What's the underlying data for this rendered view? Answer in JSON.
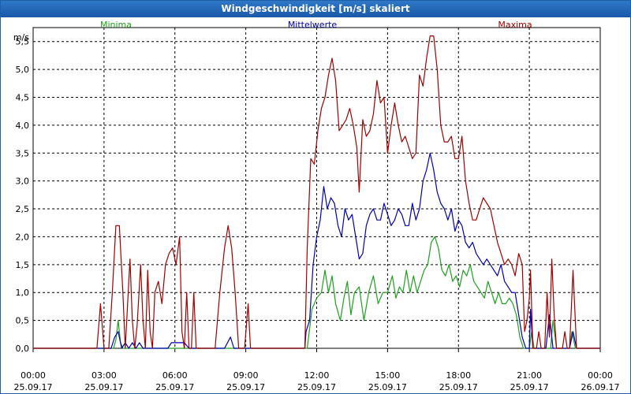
{
  "window": {
    "title": "Windgeschwindigkeit [m/s] skaliert"
  },
  "chart_data": {
    "type": "line",
    "title": "Windgeschwindigkeit [m/s] skaliert",
    "ylabel": "m/s",
    "ylim": [
      0,
      5.75
    ],
    "xlim": [
      "25.09.17 00:00",
      "26.09.17 00:00"
    ],
    "grid": true,
    "legend": "top",
    "y_ticks": [
      "0,0",
      "0,5",
      "1,0",
      "1,5",
      "2,0",
      "2,5",
      "3,0",
      "3,5",
      "4,0",
      "4,5",
      "5,0",
      "5,5"
    ],
    "x_ticks": [
      {
        "time": "00:00",
        "date": "25.09.17"
      },
      {
        "time": "03:00",
        "date": "25.09.17"
      },
      {
        "time": "06:00",
        "date": "25.09.17"
      },
      {
        "time": "09:00",
        "date": "25.09.17"
      },
      {
        "time": "12:00",
        "date": "25.09.17"
      },
      {
        "time": "15:00",
        "date": "25.09.17"
      },
      {
        "time": "18:00",
        "date": "25.09.17"
      },
      {
        "time": "21:00",
        "date": "25.09.17"
      },
      {
        "time": "00:00",
        "date": "26.09.17"
      }
    ],
    "x_unit": "hours since 25.09.17 00:00",
    "series": [
      {
        "name": "Minima",
        "color": "#1fa01f",
        "points": [
          [
            0,
            0
          ],
          [
            3.4,
            0
          ],
          [
            3.5,
            0.15
          ],
          [
            3.6,
            0.5
          ],
          [
            3.7,
            0.1
          ],
          [
            3.8,
            0
          ],
          [
            11.6,
            0
          ],
          [
            11.8,
            0.7
          ],
          [
            12,
            0.9
          ],
          [
            12.2,
            1.0
          ],
          [
            12.35,
            1.4
          ],
          [
            12.5,
            1.0
          ],
          [
            12.65,
            1.3
          ],
          [
            12.8,
            0.8
          ],
          [
            13.0,
            0.5
          ],
          [
            13.15,
            0.9
          ],
          [
            13.3,
            1.2
          ],
          [
            13.45,
            0.6
          ],
          [
            13.6,
            1.0
          ],
          [
            13.8,
            1.1
          ],
          [
            14.0,
            0.5
          ],
          [
            14.2,
            1.0
          ],
          [
            14.4,
            1.3
          ],
          [
            14.6,
            0.8
          ],
          [
            14.8,
            1.0
          ],
          [
            15.0,
            1.0
          ],
          [
            15.2,
            1.3
          ],
          [
            15.35,
            0.9
          ],
          [
            15.5,
            1.1
          ],
          [
            15.65,
            1.0
          ],
          [
            15.8,
            1.4
          ],
          [
            15.95,
            1.0
          ],
          [
            16.1,
            1.3
          ],
          [
            16.25,
            1.0
          ],
          [
            16.4,
            1.2
          ],
          [
            16.55,
            1.4
          ],
          [
            16.7,
            1.5
          ],
          [
            16.85,
            1.9
          ],
          [
            17.0,
            2.0
          ],
          [
            17.15,
            1.8
          ],
          [
            17.3,
            1.4
          ],
          [
            17.45,
            1.3
          ],
          [
            17.6,
            1.5
          ],
          [
            17.75,
            1.2
          ],
          [
            17.9,
            1.3
          ],
          [
            18.05,
            1.1
          ],
          [
            18.2,
            1.4
          ],
          [
            18.35,
            1.3
          ],
          [
            18.5,
            1.5
          ],
          [
            18.65,
            1.2
          ],
          [
            18.8,
            1.1
          ],
          [
            18.95,
            1.0
          ],
          [
            19.1,
            0.9
          ],
          [
            19.25,
            1.2
          ],
          [
            19.4,
            1.0
          ],
          [
            19.55,
            0.8
          ],
          [
            19.7,
            1.0
          ],
          [
            19.85,
            0.8
          ],
          [
            20.0,
            0.8
          ],
          [
            20.15,
            0.9
          ],
          [
            20.3,
            0.8
          ],
          [
            20.45,
            0.6
          ],
          [
            20.6,
            0.2
          ],
          [
            20.75,
            0
          ],
          [
            21.0,
            0
          ],
          [
            21.1,
            0.3
          ],
          [
            21.2,
            0
          ],
          [
            21.9,
            0
          ],
          [
            22.0,
            0.5
          ],
          [
            22.15,
            0
          ],
          [
            22.7,
            0
          ],
          [
            22.8,
            0.3
          ],
          [
            22.95,
            0
          ],
          [
            24,
            0
          ]
        ]
      },
      {
        "name": "Mittelwerte",
        "color": "#0000b4",
        "points": [
          [
            0,
            0
          ],
          [
            3.3,
            0
          ],
          [
            3.45,
            0.2
          ],
          [
            3.6,
            0.3
          ],
          [
            3.75,
            0
          ],
          [
            3.9,
            0.1
          ],
          [
            4.05,
            0
          ],
          [
            4.2,
            0.1
          ],
          [
            4.35,
            0
          ],
          [
            4.5,
            0.1
          ],
          [
            4.65,
            0
          ],
          [
            5.7,
            0
          ],
          [
            5.85,
            0.1
          ],
          [
            6.4,
            0.1
          ],
          [
            6.6,
            0
          ],
          [
            8.1,
            0
          ],
          [
            8.35,
            0.2
          ],
          [
            8.5,
            0
          ],
          [
            11.5,
            0
          ],
          [
            11.55,
            0.3
          ],
          [
            11.7,
            0.5
          ],
          [
            11.85,
            1.5
          ],
          [
            12.0,
            2.0
          ],
          [
            12.15,
            2.3
          ],
          [
            12.3,
            2.9
          ],
          [
            12.45,
            2.5
          ],
          [
            12.6,
            2.7
          ],
          [
            12.75,
            2.6
          ],
          [
            12.9,
            2.2
          ],
          [
            13.05,
            2.0
          ],
          [
            13.2,
            2.5
          ],
          [
            13.35,
            2.3
          ],
          [
            13.5,
            2.4
          ],
          [
            13.65,
            2.0
          ],
          [
            13.8,
            1.6
          ],
          [
            13.95,
            1.7
          ],
          [
            14.1,
            2.2
          ],
          [
            14.25,
            2.4
          ],
          [
            14.4,
            2.5
          ],
          [
            14.55,
            2.3
          ],
          [
            14.7,
            2.3
          ],
          [
            14.85,
            2.6
          ],
          [
            15.0,
            2.4
          ],
          [
            15.15,
            2.2
          ],
          [
            15.3,
            2.3
          ],
          [
            15.45,
            2.5
          ],
          [
            15.6,
            2.4
          ],
          [
            15.75,
            2.2
          ],
          [
            15.9,
            2.2
          ],
          [
            16.05,
            2.6
          ],
          [
            16.2,
            2.3
          ],
          [
            16.35,
            2.5
          ],
          [
            16.5,
            3.0
          ],
          [
            16.65,
            3.2
          ],
          [
            16.8,
            3.5
          ],
          [
            16.95,
            3.2
          ],
          [
            17.1,
            2.8
          ],
          [
            17.25,
            2.6
          ],
          [
            17.4,
            2.5
          ],
          [
            17.55,
            2.3
          ],
          [
            17.7,
            2.5
          ],
          [
            17.85,
            2.1
          ],
          [
            18.0,
            2.3
          ],
          [
            18.15,
            2.2
          ],
          [
            18.3,
            1.9
          ],
          [
            18.45,
            1.8
          ],
          [
            18.6,
            1.9
          ],
          [
            18.75,
            1.7
          ],
          [
            18.9,
            1.6
          ],
          [
            19.05,
            1.5
          ],
          [
            19.2,
            1.6
          ],
          [
            19.35,
            1.5
          ],
          [
            19.5,
            1.4
          ],
          [
            19.65,
            1.3
          ],
          [
            19.8,
            1.5
          ],
          [
            19.95,
            1.2
          ],
          [
            20.1,
            1.1
          ],
          [
            20.25,
            1.0
          ],
          [
            20.4,
            1.0
          ],
          [
            20.55,
            0.6
          ],
          [
            20.7,
            0.2
          ],
          [
            20.85,
            0
          ],
          [
            21.0,
            0
          ],
          [
            21.05,
            0.7
          ],
          [
            21.15,
            0
          ],
          [
            21.7,
            0
          ],
          [
            21.85,
            0.6
          ],
          [
            22.0,
            0
          ],
          [
            22.7,
            0
          ],
          [
            22.85,
            0.3
          ],
          [
            23.0,
            0
          ],
          [
            24,
            0
          ]
        ]
      },
      {
        "name": "Maxima",
        "color": "#a00000",
        "points": [
          [
            0,
            0
          ],
          [
            2.7,
            0
          ],
          [
            2.85,
            0.8
          ],
          [
            3.0,
            0
          ],
          [
            3.2,
            0
          ],
          [
            3.35,
            1.0
          ],
          [
            3.5,
            2.2
          ],
          [
            3.65,
            2.2
          ],
          [
            3.8,
            1.0
          ],
          [
            3.9,
            0
          ],
          [
            4.0,
            0.8
          ],
          [
            4.1,
            1.6
          ],
          [
            4.2,
            0.5
          ],
          [
            4.3,
            0
          ],
          [
            4.4,
            0.4
          ],
          [
            4.55,
            1.5
          ],
          [
            4.65,
            0.5
          ],
          [
            4.75,
            0
          ],
          [
            4.85,
            1.4
          ],
          [
            4.95,
            0.3
          ],
          [
            5.05,
            0
          ],
          [
            5.15,
            1.0
          ],
          [
            5.3,
            1.2
          ],
          [
            5.45,
            0.8
          ],
          [
            5.6,
            1.5
          ],
          [
            5.75,
            1.7
          ],
          [
            5.9,
            1.8
          ],
          [
            6.05,
            1.5
          ],
          [
            6.2,
            2.0
          ],
          [
            6.3,
            0.3
          ],
          [
            6.4,
            0
          ],
          [
            6.5,
            1.0
          ],
          [
            6.6,
            0
          ],
          [
            6.7,
            0
          ],
          [
            6.8,
            1.0
          ],
          [
            6.9,
            0
          ],
          [
            7.7,
            0
          ],
          [
            7.9,
            1.0
          ],
          [
            8.1,
            1.8
          ],
          [
            8.25,
            2.2
          ],
          [
            8.4,
            1.8
          ],
          [
            8.55,
            1.0
          ],
          [
            8.7,
            0
          ],
          [
            8.95,
            0
          ],
          [
            9.1,
            0.8
          ],
          [
            9.2,
            0
          ],
          [
            11.5,
            0
          ],
          [
            11.6,
            1.8
          ],
          [
            11.75,
            3.4
          ],
          [
            11.9,
            3.3
          ],
          [
            12.05,
            3.9
          ],
          [
            12.2,
            4.3
          ],
          [
            12.35,
            4.5
          ],
          [
            12.5,
            4.9
          ],
          [
            12.65,
            5.2
          ],
          [
            12.8,
            4.8
          ],
          [
            12.95,
            3.9
          ],
          [
            13.1,
            4.0
          ],
          [
            13.25,
            4.1
          ],
          [
            13.4,
            4.3
          ],
          [
            13.55,
            4.0
          ],
          [
            13.7,
            3.6
          ],
          [
            13.8,
            2.8
          ],
          [
            13.95,
            4.1
          ],
          [
            14.1,
            3.8
          ],
          [
            14.25,
            3.9
          ],
          [
            14.4,
            4.2
          ],
          [
            14.55,
            4.8
          ],
          [
            14.7,
            4.4
          ],
          [
            14.85,
            4.5
          ],
          [
            15.0,
            3.5
          ],
          [
            15.15,
            4.0
          ],
          [
            15.3,
            4.4
          ],
          [
            15.45,
            4.0
          ],
          [
            15.6,
            3.7
          ],
          [
            15.75,
            3.8
          ],
          [
            15.9,
            3.6
          ],
          [
            16.05,
            3.4
          ],
          [
            16.2,
            3.5
          ],
          [
            16.35,
            4.9
          ],
          [
            16.5,
            4.7
          ],
          [
            16.65,
            5.2
          ],
          [
            16.8,
            5.6
          ],
          [
            16.95,
            5.6
          ],
          [
            17.1,
            5.0
          ],
          [
            17.25,
            4.0
          ],
          [
            17.4,
            3.7
          ],
          [
            17.55,
            3.7
          ],
          [
            17.7,
            3.8
          ],
          [
            17.85,
            3.4
          ],
          [
            18.0,
            3.4
          ],
          [
            18.15,
            3.8
          ],
          [
            18.3,
            3.0
          ],
          [
            18.45,
            2.6
          ],
          [
            18.6,
            2.3
          ],
          [
            18.75,
            2.3
          ],
          [
            18.9,
            2.5
          ],
          [
            19.05,
            2.7
          ],
          [
            19.2,
            2.6
          ],
          [
            19.35,
            2.5
          ],
          [
            19.5,
            2.2
          ],
          [
            19.65,
            1.9
          ],
          [
            19.8,
            1.7
          ],
          [
            19.95,
            1.5
          ],
          [
            20.1,
            1.6
          ],
          [
            20.25,
            1.5
          ],
          [
            20.4,
            1.3
          ],
          [
            20.55,
            1.7
          ],
          [
            20.7,
            1.5
          ],
          [
            20.8,
            0.3
          ],
          [
            20.9,
            0.5
          ],
          [
            21.0,
            0.9
          ],
          [
            21.05,
            1.4
          ],
          [
            21.15,
            0
          ],
          [
            21.3,
            0
          ],
          [
            21.4,
            0.3
          ],
          [
            21.5,
            0
          ],
          [
            21.65,
            0
          ],
          [
            21.75,
            1.0
          ],
          [
            21.85,
            0.2
          ],
          [
            21.95,
            1.6
          ],
          [
            22.05,
            0.6
          ],
          [
            22.15,
            0
          ],
          [
            22.4,
            0
          ],
          [
            22.5,
            0.3
          ],
          [
            22.6,
            0
          ],
          [
            22.7,
            0
          ],
          [
            22.85,
            1.4
          ],
          [
            23.0,
            0
          ],
          [
            24,
            0
          ]
        ]
      }
    ]
  }
}
